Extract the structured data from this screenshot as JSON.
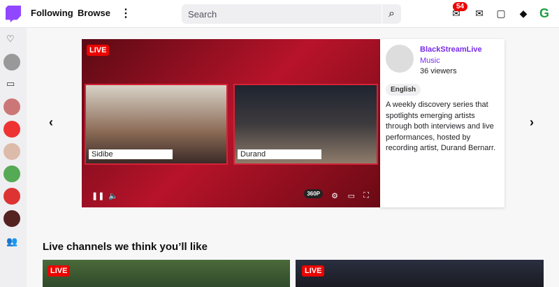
{
  "nav": {
    "following": "Following",
    "browse": "Browse",
    "more_icon": "more-vertical-icon"
  },
  "search": {
    "placeholder": "Search"
  },
  "notifications": {
    "count": "54"
  },
  "featured": {
    "live_badge": "LIVE",
    "left_name": "Sidibe",
    "right_name": "Durand",
    "quality": "360P",
    "channel": "BlackStreamLive",
    "category": "Music",
    "viewers": "36 viewers",
    "tag": "English",
    "description": "A weekly discovery series that spotlights emerging artists through both interviews and live performances, hosted by recording artist, Durand Bernarr."
  },
  "section_title": "Live channels we think you’ll like",
  "cards": [
    {
      "live": "LIVE"
    },
    {
      "live": "LIVE"
    }
  ],
  "colors": {
    "brand": "#9147ff",
    "live": "#eb0400",
    "link": "#772ce8"
  }
}
